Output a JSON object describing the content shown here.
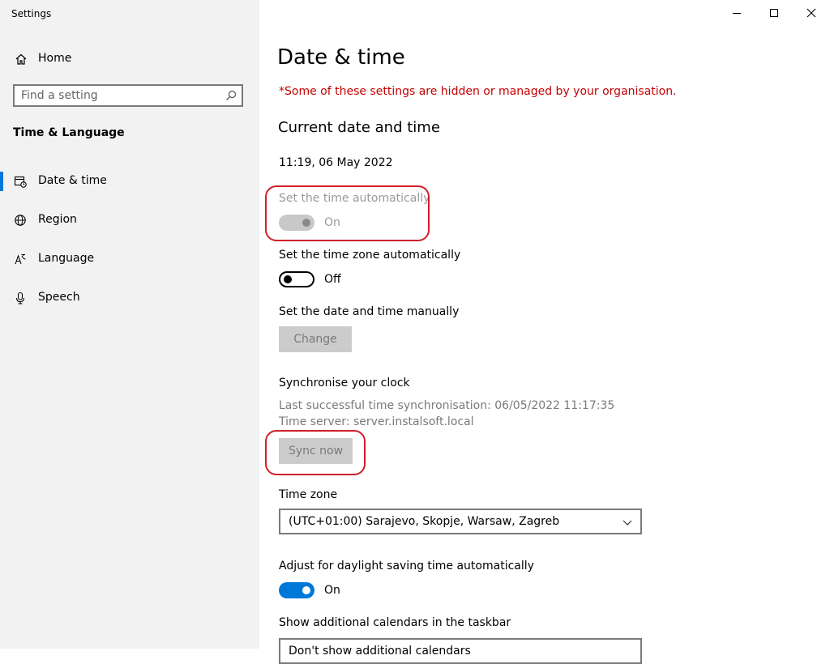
{
  "window": {
    "title": "Settings"
  },
  "sidebar": {
    "home_label": "Home",
    "search_placeholder": "Find a setting",
    "section_label": "Time & Language",
    "items": [
      {
        "label": "Date & time",
        "icon": "calendar-clock-icon",
        "active": true
      },
      {
        "label": "Region",
        "icon": "globe-icon",
        "active": false
      },
      {
        "label": "Language",
        "icon": "language-icon",
        "active": false
      },
      {
        "label": "Speech",
        "icon": "microphone-icon",
        "active": false
      }
    ]
  },
  "main": {
    "title": "Date & time",
    "managed_note": "*Some of these settings are hidden or managed by your organisation.",
    "current_heading": "Current date and time",
    "current_datetime": "11:19, 06 May 2022",
    "auto_time": {
      "label": "Set the time automatically",
      "state": "On",
      "enabled": false
    },
    "auto_timezone": {
      "label": "Set the time zone automatically",
      "state": "Off"
    },
    "manual": {
      "label": "Set the date and time manually",
      "button": "Change"
    },
    "sync": {
      "heading": "Synchronise your clock",
      "last_sync": "Last successful time synchronisation: 06/05/2022 11:17:35",
      "server": "Time server: server.instalsoft.local",
      "button": "Sync now"
    },
    "timezone": {
      "label": "Time zone",
      "value": "(UTC+01:00) Sarajevo, Skopje, Warsaw, Zagreb"
    },
    "daylight": {
      "label": "Adjust for daylight saving time automatically",
      "state": "On"
    },
    "calendars": {
      "label": "Show additional calendars in the taskbar",
      "value": "Don't show additional calendars"
    }
  },
  "colors": {
    "accent": "#0078d7",
    "warning": "#c50000",
    "annotation": "#d0202a"
  }
}
